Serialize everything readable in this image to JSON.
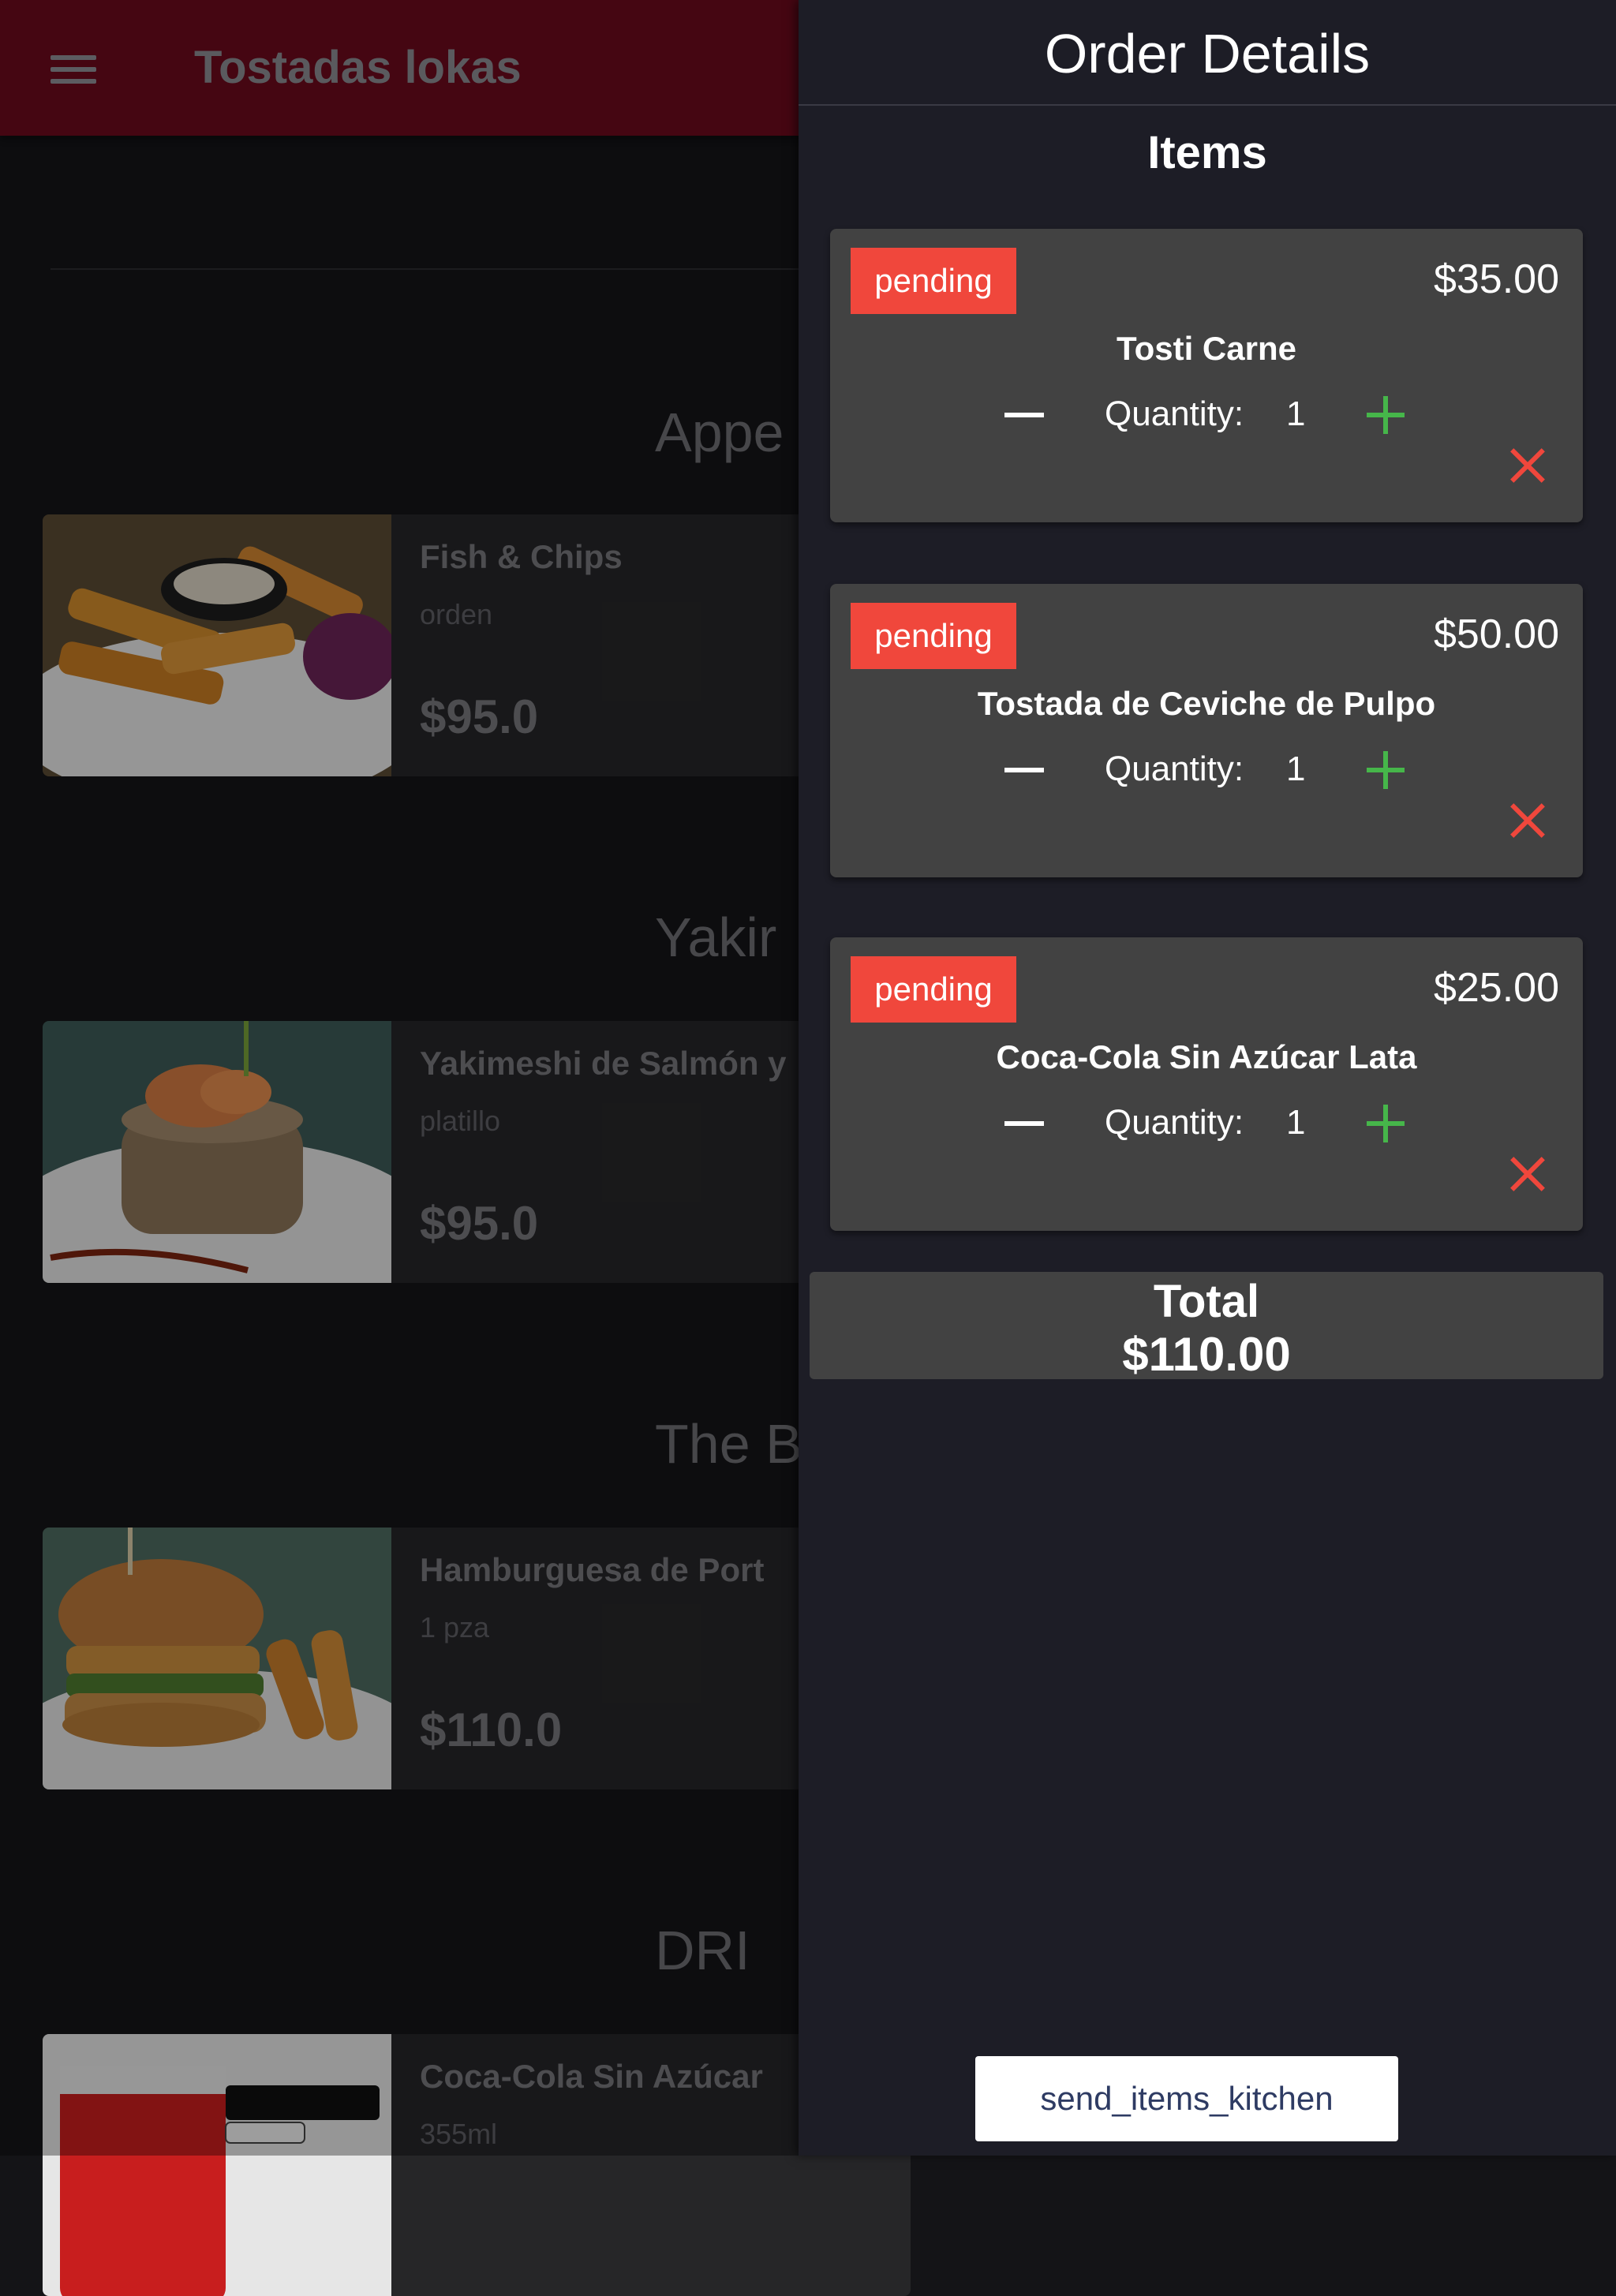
{
  "app": {
    "title": "Tostadas lokas"
  },
  "menu": {
    "sections": [
      {
        "title": "Appe"
      },
      {
        "title": "Yakir"
      },
      {
        "title": "The B"
      },
      {
        "title": "DRI"
      }
    ],
    "items": [
      {
        "name": "Fish & Chips",
        "desc": "orden",
        "price": "$95.0"
      },
      {
        "name": "Yakimeshi de Salmón y",
        "desc": "platillo",
        "price": "$95.0"
      },
      {
        "name": "Hamburguesa de Port",
        "desc": "1 pza",
        "price": "$110.0"
      },
      {
        "name": "Coca-Cola Sin Azúcar",
        "desc": "355ml",
        "price": ""
      }
    ]
  },
  "drawer": {
    "title": "Order Details",
    "items_heading": "Items",
    "orders": [
      {
        "status": "pending",
        "price": "$35.00",
        "name": "Tosti Carne",
        "quantity_label": "Quantity:",
        "quantity": "1"
      },
      {
        "status": "pending",
        "price": "$50.00",
        "name": "Tostada de Ceviche de Pulpo",
        "quantity_label": "Quantity:",
        "quantity": "1"
      },
      {
        "status": "pending",
        "price": "$25.00",
        "name": "Coca-Cola Sin Azúcar Lata",
        "quantity_label": "Quantity:",
        "quantity": "1"
      }
    ],
    "total_label": "Total",
    "total_value": "$110.00",
    "send_button": "send_items_kitchen"
  },
  "colors": {
    "appbar": "#6b0a1d",
    "badge": "#f0473c",
    "plus": "#46b64a",
    "remove": "#f0473c"
  },
  "icons": [
    "hamburger-menu-icon",
    "minus-icon",
    "plus-icon",
    "close-icon"
  ]
}
